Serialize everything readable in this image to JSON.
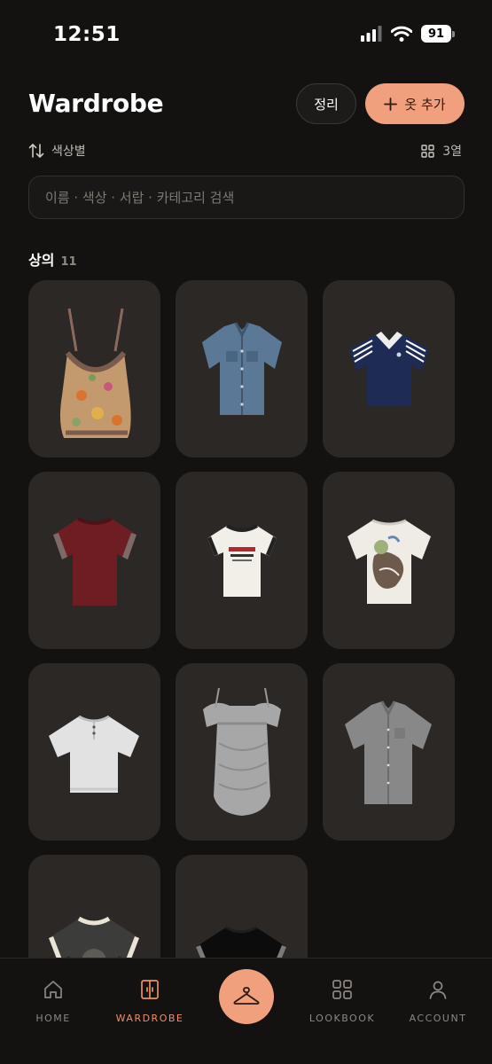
{
  "status_bar": {
    "time": "12:51",
    "battery": "91"
  },
  "header": {
    "title": "Wardrobe",
    "organize_label": "정리",
    "add_label": "옷 추가"
  },
  "toolbar": {
    "sort_label": "색상별",
    "columns_label": "3열"
  },
  "search": {
    "placeholder": "이름 · 색상 · 서랍 · 카테고리 검색",
    "value": ""
  },
  "section": {
    "title": "상의",
    "count": "11"
  },
  "items": [
    {
      "icon": "floral-camisole-top"
    },
    {
      "icon": "denim-short-sleeve-shirt"
    },
    {
      "icon": "navy-polo-shirt"
    },
    {
      "icon": "burgundy-tshirt"
    },
    {
      "icon": "white-ringer-tshirt"
    },
    {
      "icon": "white-graphic-tshirt"
    },
    {
      "icon": "grey-henley-knit"
    },
    {
      "icon": "grey-draped-top"
    },
    {
      "icon": "grey-short-sleeve-shirt"
    },
    {
      "icon": "charcoal-vintage-tee"
    },
    {
      "icon": "black-tshirt"
    }
  ],
  "colors": {
    "accent": "#f1a07e",
    "accent_text": "#ef8f63",
    "background": "#141211",
    "card": "#2b2826"
  },
  "tabbar": {
    "home": "HOME",
    "wardrobe": "WARDROBE",
    "lookbook": "LOOKBOOK",
    "account": "ACCOUNT",
    "center_icon": "hanger-icon"
  }
}
